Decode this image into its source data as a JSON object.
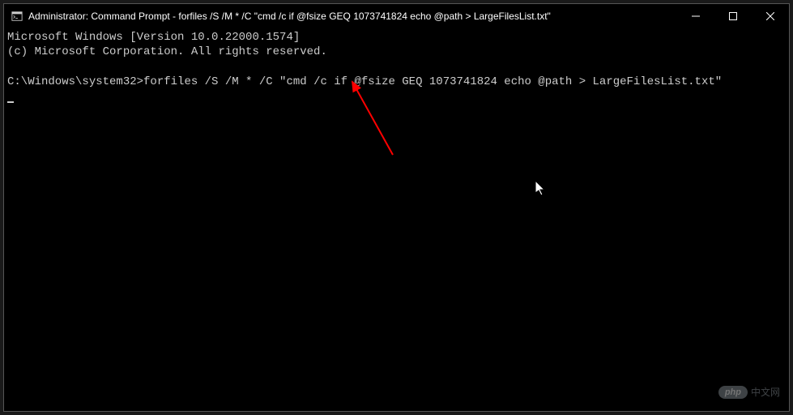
{
  "titlebar": {
    "title": "Administrator: Command Prompt - forfiles  /S /M * /C \"cmd /c if @fsize GEQ 1073741824 echo @path > LargeFilesList.txt\""
  },
  "terminal": {
    "line1": "Microsoft Windows [Version 10.0.22000.1574]",
    "line2": "(c) Microsoft Corporation. All rights reserved.",
    "prompt": "C:\\Windows\\system32>",
    "command": "forfiles /S /M * /C \"cmd /c if @fsize GEQ 1073741824 echo @path > LargeFilesList.txt\""
  },
  "watermark": {
    "badge": "php",
    "text": "中文网"
  }
}
